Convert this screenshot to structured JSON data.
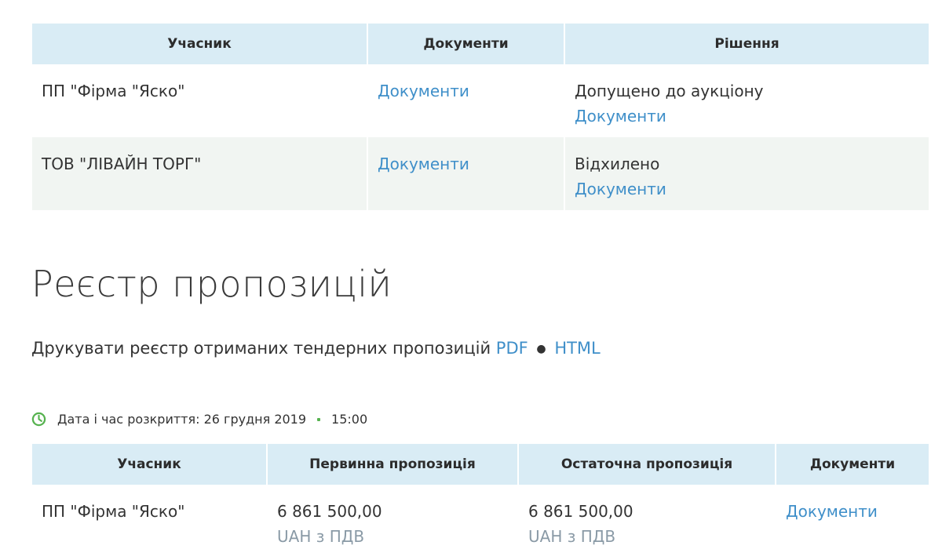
{
  "decisions_table": {
    "headers": [
      "Учасник",
      "Документи",
      "Рішення"
    ],
    "rows": [
      {
        "participant": "ПП \"Фірма \"Яско\"",
        "docs": "Документи",
        "decision": "Допущено до аукціону",
        "decision_docs": "Документи"
      },
      {
        "participant": "ТОВ \"ЛІВАЙН ТОРГ\"",
        "docs": "Документи",
        "decision": "Відхилено",
        "decision_docs": "Документи"
      }
    ]
  },
  "registry": {
    "title": "Реєстр пропозицій",
    "print_label": "Друкувати реєстр отриманих тендерних пропозицій",
    "pdf_link": "PDF",
    "dot": "●",
    "html_link": "HTML",
    "date_label": "Дата і час розкриття: 26 грудня 2019",
    "time": "15:00"
  },
  "offers_table": {
    "headers": [
      "Учасник",
      "Первинна пропозиція",
      "Остаточна пропозиція",
      "Документи"
    ],
    "rows": [
      {
        "participant": "ПП \"Фірма \"Яско\"",
        "initial_amount": "6 861 500,00",
        "initial_currency": "UAH з ПДВ",
        "final_amount": "6 861 500,00",
        "final_currency": "UAH з ПДВ",
        "docs": "Документи"
      }
    ]
  },
  "colors": {
    "header_bg": "#d9ecf5",
    "link": "#3f8fc9",
    "row_alt": "#f1f5f2",
    "clock": "#56b24f"
  }
}
